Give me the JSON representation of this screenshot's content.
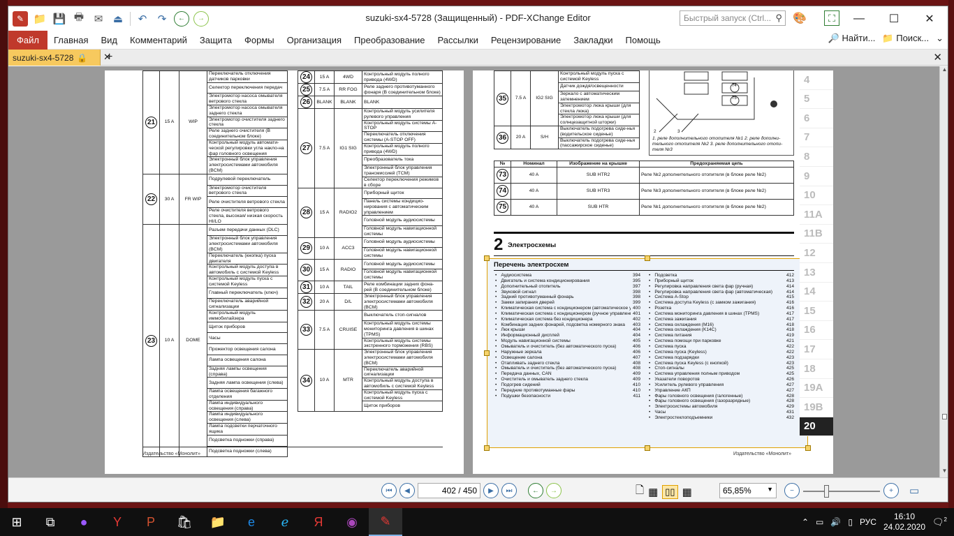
{
  "window": {
    "title": "suzuki-sx4-5728 (Защищенный) - PDF-XChange Editor",
    "quick_search_placeholder": "Быстрый запуск (Ctrl..."
  },
  "menu": {
    "file": "Файл",
    "items": [
      "Главная",
      "Вид",
      "Комментарий",
      "Защита",
      "Формы",
      "Организация",
      "Преобразование",
      "Рассылки",
      "Рецензирование",
      "Закладки",
      "Помощь"
    ],
    "find": "Найти...",
    "search": "Поиск..."
  },
  "tab": {
    "name": "suzuki-sx4-5728"
  },
  "left_page": {
    "publisher": "Издательство «Монолит»",
    "col1": [
      {
        "num": "21",
        "amp": "15 A",
        "name": "WIP",
        "items": [
          "Переключатель отключения датчиков парковки",
          "Селектор переключения передач",
          "Электромотор насоса омывателя ветрового стекла",
          "Электромотор насоса омывателя заднего стекла",
          "Электромотор очистителя заднего стекла",
          "Реле заднего очистителя (В соединительном блоке)",
          "Контрольный модуль автомати-ческой регулировки угла накло-на фар головного освещения",
          "Электронный блок управления электросистемами автомобиля (BCM)"
        ]
      },
      {
        "num": "22",
        "amp": "30 A",
        "name": "FR WIP",
        "items": [
          "Подрулевой переключатель",
          "Электромотор очистителя ветрового стекла",
          "Реле очистителя ветрового стекла",
          "Реле очистителя ветрового стекла, высокая/ низкая скорость HI/LO"
        ]
      },
      {
        "num": "23",
        "amp": "10 A",
        "name": "DOME",
        "items": [
          "Разъем передачи данных (DLC)",
          "Электронный блок управления электросистемами автомобиля (BCM)",
          "Переключатель (кнопка) пуска двигателя",
          "Контрольный модуль доступа в автомобиль с системой Keyless",
          "Контрольный модуль пуска с системой Keyless",
          "Главный переключатель (ключ)",
          "Переключатель аварийной сигнализации",
          "Контрольный модуль иммобилайзера",
          "Щиток приборов",
          "Часы",
          "Прожектор освещения салона",
          "Лампа освещения салона",
          "Задняя лампы освещения (справа)",
          "Задняя лампа освещения (слева)",
          "Лампа освещения багажного отделения",
          "Лампа индивидуального освещения (справа)",
          "Лампа индивидуального освещения (слева)",
          "Лампа подсветки перчаточного ящика",
          "Подсветка подножки (справа)",
          "Подсветка подножки (слева)"
        ]
      }
    ],
    "col2": [
      {
        "num": "24",
        "amp": "15 A",
        "name": "4WD",
        "items": [
          "Контрольный модуль полного привода (4WD)"
        ]
      },
      {
        "num": "25",
        "amp": "7.5 A",
        "name": "RR FOG",
        "items": [
          "Реле заднего противотуманного фонаря (В соединительном блоке)"
        ]
      },
      {
        "num": "26",
        "amp": "BLANK",
        "name": "BLANK",
        "items": [
          "BLANK"
        ]
      },
      {
        "num": "27",
        "amp": "7.5 A",
        "name": "IG1 SIG",
        "items": [
          "Контрольный модуль усилителя рулевого управления",
          "Контрольный модуль системы A-STOP",
          "Переключатель отключения системы (A-STOP OFF)",
          "Контрольный модуль полного привода (4WD)",
          "Преобразователь тока",
          "Электронный блок управления трансмиссией (TCM)",
          "Селектор переключения режимов в сборе"
        ]
      },
      {
        "num": "28",
        "amp": "15 A",
        "name": "RADIO2",
        "items": [
          "Приборный щиток",
          "Панель системы кондицио-нирования с автоматическим управлением",
          "Головной модуль аудиосистемы",
          "Головной модуль навигационной системы"
        ]
      },
      {
        "num": "29",
        "amp": "10 A",
        "name": "ACC3",
        "items": [
          "Головной модуль аудиосистемы",
          "Головной модуль навигационной системы"
        ]
      },
      {
        "num": "30",
        "amp": "15 A",
        "name": "RADIO",
        "items": [
          "Головной модуль аудиосистемы",
          "Головной модуль навигационной системы"
        ]
      },
      {
        "num": "31",
        "amp": "10 A",
        "name": "TAIL",
        "items": [
          "Реле комбинации задних фона-рей (В соединительном блоке)"
        ]
      },
      {
        "num": "32",
        "amp": "20 A",
        "name": "D/L",
        "items": [
          "Электронный блок управления электросистемами автомобиля (BCM)"
        ]
      },
      {
        "num": "33",
        "amp": "7.5 A",
        "name": "CRUISE",
        "items": [
          "Выключатель стоп-сигналов",
          "Контрольный модуль системы мониторинга давления в шинах (TPMS)",
          "Контрольный модуль системы экстренного торможения (RBS)"
        ]
      },
      {
        "num": "34",
        "amp": "10 A",
        "name": "MTR",
        "items": [
          "Электронный блок управления электросистемами автомобиля (BCM)",
          "Переключатель аварийной сигнализации",
          "Контрольный модуль доступа в автомобиль с системой Keyless",
          "Контрольный модуль пуска с системой Keyless",
          "Щиток приборов"
        ]
      }
    ]
  },
  "right_page": {
    "publisher": "Издательство «Монолит»",
    "top_fuses": [
      {
        "num": "35",
        "amp": "7.5 A",
        "name": "IG2 SIG",
        "items": [
          "Контрольный модуль пуска с системой Keyless",
          "Датчик дождя/освещенности",
          "Зеркало с автоматическим затемнением",
          "Электромотор люка крыши (для стекла люка)",
          "Электромотор люка крыши (для солнцезащитной шторки)"
        ]
      },
      {
        "num": "36",
        "amp": "20 A",
        "name": "S/H",
        "items": [
          "Выключатель подогрева сиде-нья (водительское сиденье)",
          "Выключатель подогрева сиде-нья (пассажирское сиденье)"
        ]
      }
    ],
    "diagram": {
      "labels": [
        "74",
        "75",
        "2",
        "3"
      ],
      "caption": "1. реле дополнительного отопителя №1 2. реле дополни-тельного отопителя №2 3. реле дополнительного отопи-теля №3"
    },
    "relay_table": {
      "headers": [
        "№",
        "Номинал",
        "Изображение на крышке",
        "Предохраняемая цепь"
      ],
      "rows": [
        {
          "num": "73",
          "amp": "40 A",
          "name": "SUB HTR2",
          "circuit": "Реле №2 дополнительного отопителя (в блоке реле №2)"
        },
        {
          "num": "74",
          "amp": "40 A",
          "name": "SUB HTR3",
          "circuit": "Реле №3 дополнительного отопителя (в блоке реле №2)"
        },
        {
          "num": "75",
          "amp": "40 A",
          "name": "SUB HTR",
          "circuit": "Реле №1 дополнительного отопителя (в блоке реле №2)"
        }
      ]
    },
    "section_num": "2",
    "section_title": "Электросхемы",
    "list_title": "Перечень электросхем",
    "left_list": [
      [
        "Аудиосистема",
        "394"
      ],
      [
        "Двигатель и система кондиционирования",
        "395"
      ],
      [
        "Дополнительный отопитель",
        "397"
      ],
      [
        "Звуковой сигнал",
        "398"
      ],
      [
        "Задний противотуманный фонарь",
        "398"
      ],
      [
        "Замки запирания дверей",
        "399"
      ],
      [
        "Климатическая система с кондиционером (автоматическое управление)",
        "400"
      ],
      [
        "Климатическая система с кондиционером (ручное управление)",
        "401"
      ],
      [
        "Климатическая система без кондиционера",
        "402"
      ],
      [
        "Комбинация задних фонарей, подсветка номерного знака",
        "403"
      ],
      [
        "Люк крыши",
        "404"
      ],
      [
        "Информационный дисплей",
        "404"
      ],
      [
        "Модуль навигационной системы",
        "405"
      ],
      [
        "Омыватель и очиститель (без автоматического пуска)",
        "406"
      ],
      [
        "Наружные зеркала",
        "406"
      ],
      [
        "Освещение салона",
        "407"
      ],
      [
        "Отапливать заднего стекла",
        "408"
      ],
      [
        "Омыватель и очиститель (без автоматического пуска)",
        "408"
      ],
      [
        "Передача данных, CAN",
        "409"
      ],
      [
        "Очиститель и омыватель заднего стекла",
        "409"
      ],
      [
        "Подогрев сидений",
        "410"
      ],
      [
        "Передние противотуманные фары",
        "410"
      ],
      [
        "Подушки безопасности",
        "411"
      ]
    ],
    "right_list": [
      [
        "Подсветка",
        "412"
      ],
      [
        "Приборный щиток",
        "413"
      ],
      [
        "Регулировка направления света фар (ручная)",
        "414"
      ],
      [
        "Регулировка направления света фар (автоматическая)",
        "414"
      ],
      [
        "Система A-Stop",
        "415"
      ],
      [
        "Система доступа Keyless (с замком зажигания)",
        "416"
      ],
      [
        "Розетка",
        "416"
      ],
      [
        "Система мониторинга давления в шинах (TPMS)",
        "417"
      ],
      [
        "Система зажигания",
        "417"
      ],
      [
        "Система охлаждения (M16)",
        "418"
      ],
      [
        "Система охлаждения (K14C)",
        "418"
      ],
      [
        "Система питания",
        "419"
      ],
      [
        "Система помощи при парковке",
        "421"
      ],
      [
        "Система пуска",
        "422"
      ],
      [
        "Система пуска (Keyless)",
        "422"
      ],
      [
        "Система подзарядки",
        "423"
      ],
      [
        "Система пуска Keyless (с кнопкой)",
        "423"
      ],
      [
        "Стоп-сигналы",
        "425"
      ],
      [
        "Система управления полным приводом",
        "425"
      ],
      [
        "Указатели поворотов",
        "426"
      ],
      [
        "Усилитель рулевого управления",
        "427"
      ],
      [
        "Управление АКП",
        "427"
      ],
      [
        "Фары головного освещения (галогенные)",
        "428"
      ],
      [
        "Фары головного освещения (газоразрядные)",
        "428"
      ],
      [
        "Электросистемы автомобиля",
        "429"
      ],
      [
        "Часы",
        "431"
      ],
      [
        "Электростеклоподъемники",
        "432"
      ]
    ],
    "side_tabs": [
      "4",
      "5",
      "6",
      "7",
      "8",
      "9",
      "10",
      "11A",
      "11B",
      "12",
      "13",
      "14",
      "15",
      "16",
      "17",
      "18",
      "19A",
      "19B",
      "20"
    ],
    "active_tab": "20"
  },
  "statusbar": {
    "page": "402",
    "total": "/ 450",
    "zoom": "65,85%"
  },
  "taskbar": {
    "lang": "РУС",
    "time": "16:10",
    "date": "24.02.2020",
    "notif": "2"
  }
}
